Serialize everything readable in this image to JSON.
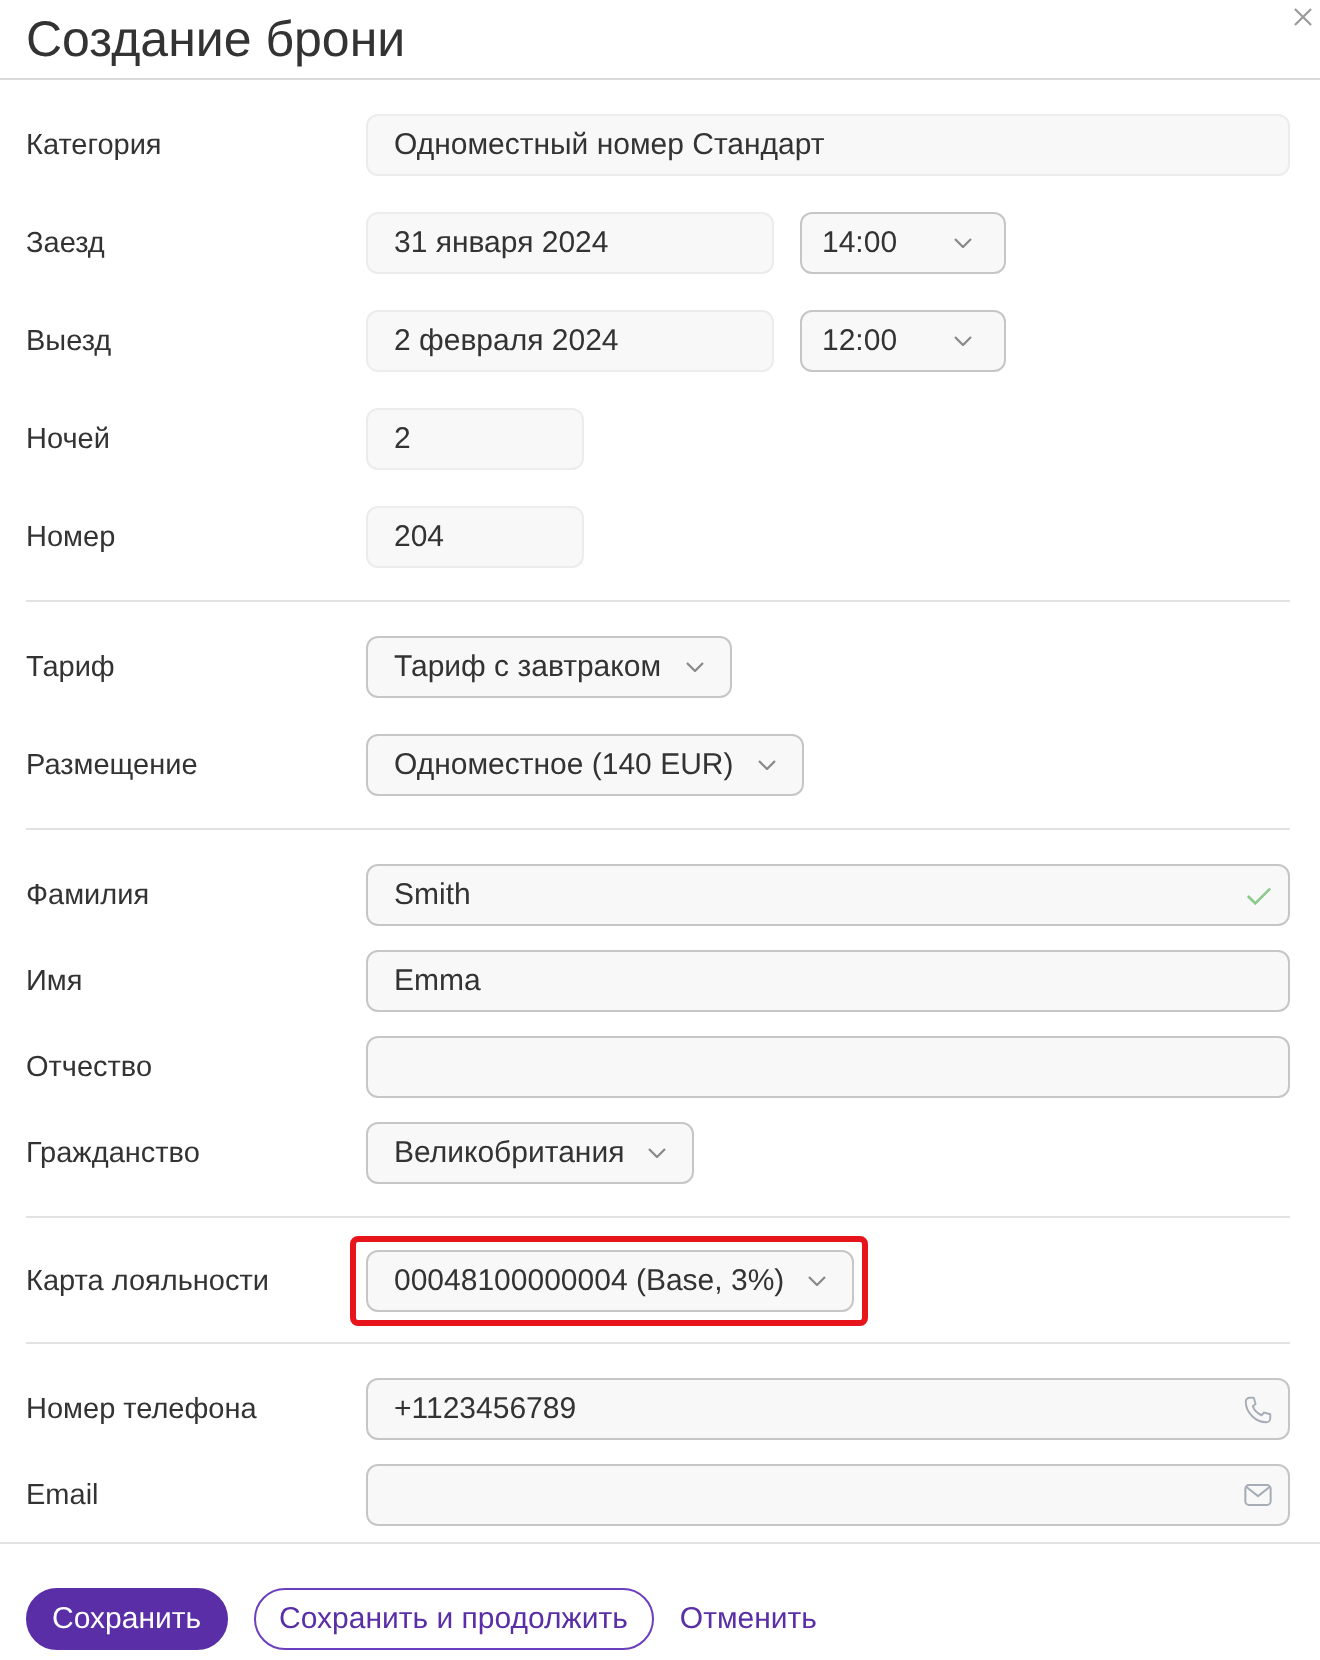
{
  "dialog": {
    "title": "Создание брони"
  },
  "sections": [
    {
      "rows": [
        {
          "label": "Категория",
          "highlighted": false,
          "fields": [
            {
              "kind": "static",
              "value": "Одноместный номер Стандарт"
            }
          ]
        },
        {
          "label": "Заезд",
          "highlighted": false,
          "fields": [
            {
              "kind": "static",
              "value": "31 января 2024"
            },
            {
              "kind": "select",
              "value": "14:00"
            }
          ]
        },
        {
          "label": "Выезд",
          "highlighted": false,
          "fields": [
            {
              "kind": "static",
              "value": "2 февраля 2024"
            },
            {
              "kind": "select",
              "value": "12:00"
            }
          ]
        },
        {
          "label": "Ночей",
          "highlighted": false,
          "fields": [
            {
              "kind": "static",
              "value": "2"
            }
          ]
        },
        {
          "label": "Номер",
          "highlighted": false,
          "fields": [
            {
              "kind": "static",
              "value": "204"
            }
          ]
        }
      ]
    },
    {
      "rows": [
        {
          "label": "Тариф",
          "highlighted": false,
          "fields": [
            {
              "kind": "select",
              "value": "Тариф с завтраком"
            }
          ]
        },
        {
          "label": "Размещение",
          "highlighted": false,
          "fields": [
            {
              "kind": "select",
              "value": "Одноместное (140 EUR)"
            }
          ]
        }
      ]
    },
    {
      "rows": [
        {
          "label": "Фамилия",
          "highlighted": false,
          "fields": [
            {
              "kind": "text",
              "value": "Smith",
              "valid": true
            }
          ]
        },
        {
          "label": "Имя",
          "highlighted": false,
          "fields": [
            {
              "kind": "text",
              "value": "Emma",
              "valid": false
            }
          ]
        },
        {
          "label": "Отчество",
          "highlighted": false,
          "fields": [
            {
              "kind": "text",
              "valid": false
            }
          ]
        },
        {
          "label": "Гражданство",
          "highlighted": false,
          "fields": [
            {
              "kind": "select",
              "value": "Великобритания"
            }
          ]
        }
      ]
    },
    {
      "rows": [
        {
          "label": "Карта лояльности",
          "highlighted": true,
          "fields": [
            {
              "kind": "select",
              "value": "00048100000004 (Base, 3%)"
            }
          ]
        }
      ]
    },
    {
      "rows": [
        {
          "label": "Номер телефона",
          "highlighted": false,
          "fields": [
            {
              "kind": "phone",
              "value": "+1123456789"
            }
          ]
        },
        {
          "label": "Email",
          "highlighted": false,
          "fields": [
            {
              "kind": "email"
            }
          ]
        }
      ]
    }
  ],
  "buttons": [
    {
      "kind": "primary",
      "label": "Сохранить"
    },
    {
      "kind": "secondary",
      "label": "Сохранить и продолжить"
    },
    {
      "kind": "link",
      "label": "Отменить"
    }
  ]
}
